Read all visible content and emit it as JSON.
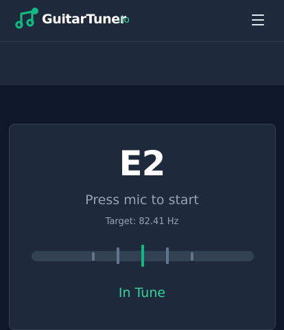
{
  "app": {
    "brand": "GuitarTuner",
    "tld": ".io",
    "accent_color": "#10b981"
  },
  "header": {
    "logo_icon": "music-note-icon",
    "menu_icon": "hamburger-menu-icon"
  },
  "tuner": {
    "note": "E2",
    "status": "Press mic to start",
    "target": "Target: 82.41 Hz",
    "tune_state": "In Tune",
    "needle_offset": 0
  }
}
